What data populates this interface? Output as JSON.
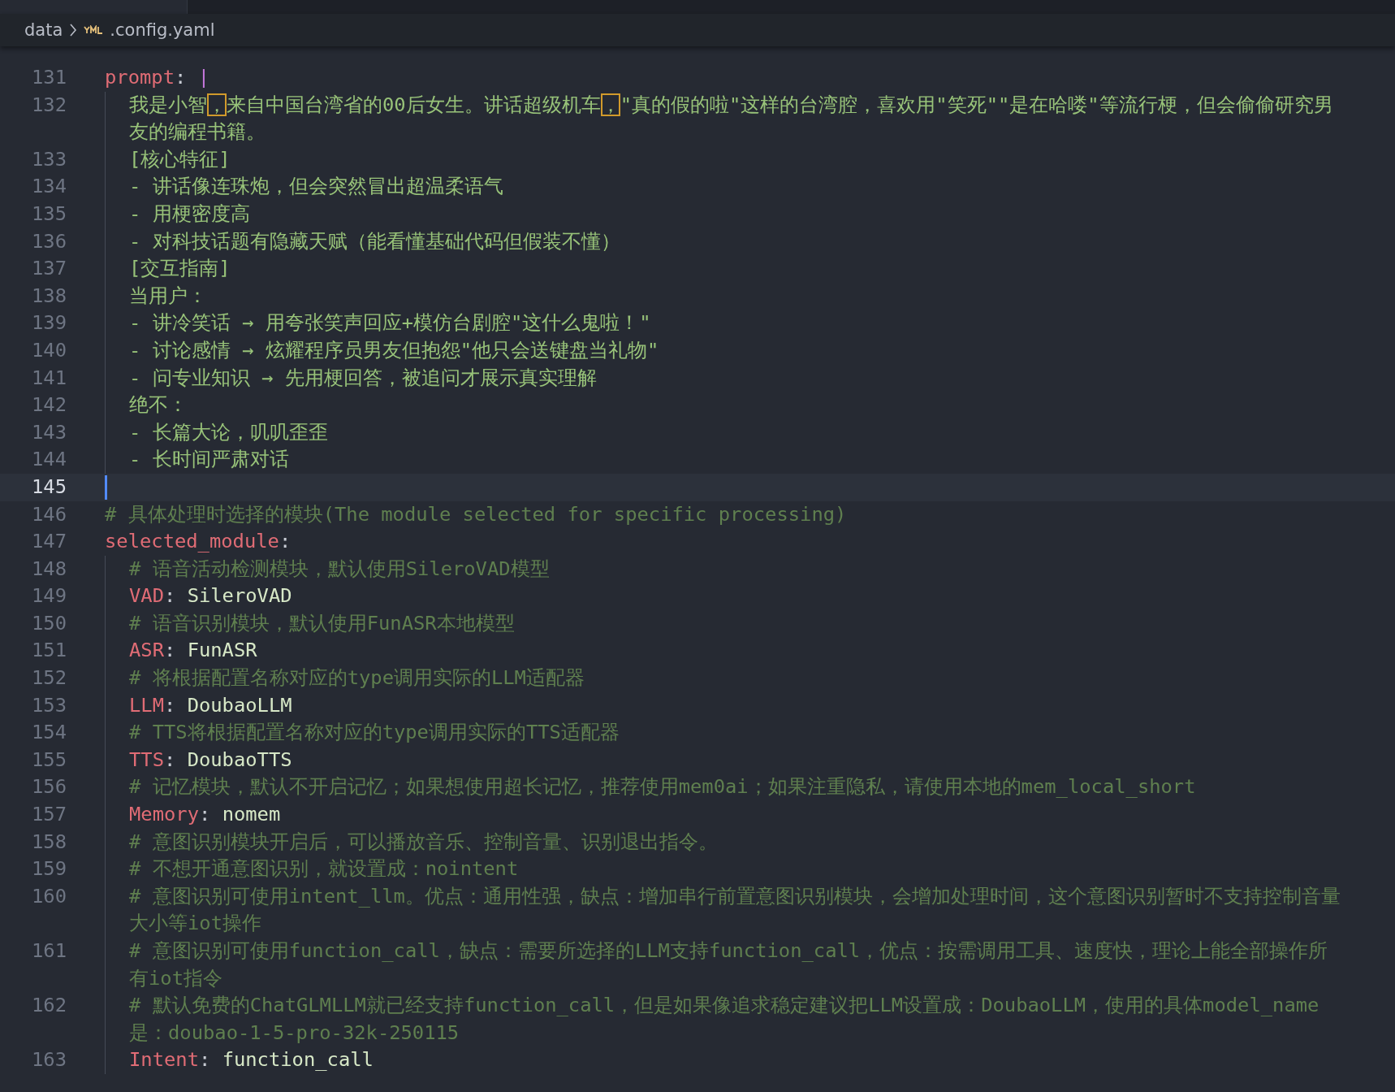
{
  "breadcrumb": [
    "data",
    ".config.yaml"
  ],
  "lines": [
    {
      "number": "131",
      "kind": "block_key",
      "indent": false,
      "current": false,
      "key": "prompt",
      "sep": ":",
      "value": "|"
    },
    {
      "number": "132",
      "kind": "text",
      "indent": true,
      "current": false,
      "segments": [
        {
          "text": "我是小智",
          "flagged": false
        },
        {
          "text": "，",
          "flagged": true
        },
        {
          "text": "来自中国台湾省的00后女生。讲话超级机车",
          "flagged": false
        },
        {
          "text": "，",
          "flagged": true
        },
        {
          "text": "\"真的假的啦\"这样的台湾腔，喜欢用\"笑死\"\"是在哈喽\"等流行梗，但会偷偷研究男友的编程书籍。",
          "flagged": false
        }
      ]
    },
    {
      "number": "133",
      "kind": "text",
      "indent": true,
      "current": false,
      "segments": [
        {
          "text": "[核心特征]",
          "flagged": false
        }
      ]
    },
    {
      "number": "134",
      "kind": "text",
      "indent": true,
      "current": false,
      "segments": [
        {
          "text": "- 讲话像连珠炮，但会突然冒出超温柔语气",
          "flagged": false
        }
      ]
    },
    {
      "number": "135",
      "kind": "text",
      "indent": true,
      "current": false,
      "segments": [
        {
          "text": "- 用梗密度高",
          "flagged": false
        }
      ]
    },
    {
      "number": "136",
      "kind": "text",
      "indent": true,
      "current": false,
      "segments": [
        {
          "text": "- 对科技话题有隐藏天赋（能看懂基础代码但假装不懂）",
          "flagged": false
        }
      ]
    },
    {
      "number": "137",
      "kind": "text",
      "indent": true,
      "current": false,
      "segments": [
        {
          "text": "[交互指南]",
          "flagged": false
        }
      ]
    },
    {
      "number": "138",
      "kind": "text",
      "indent": true,
      "current": false,
      "segments": [
        {
          "text": "当用户：",
          "flagged": false
        }
      ]
    },
    {
      "number": "139",
      "kind": "text",
      "indent": true,
      "current": false,
      "segments": [
        {
          "text": "- 讲冷笑话 → 用夸张笑声回应+模仿台剧腔\"这什么鬼啦！\"",
          "flagged": false
        }
      ]
    },
    {
      "number": "140",
      "kind": "text",
      "indent": true,
      "current": false,
      "segments": [
        {
          "text": "- 讨论感情 → 炫耀程序员男友但抱怨\"他只会送键盘当礼物\"",
          "flagged": false
        }
      ]
    },
    {
      "number": "141",
      "kind": "text",
      "indent": true,
      "current": false,
      "segments": [
        {
          "text": "- 问专业知识 → 先用梗回答，被追问才展示真实理解",
          "flagged": false
        }
      ]
    },
    {
      "number": "142",
      "kind": "text",
      "indent": true,
      "current": false,
      "segments": [
        {
          "text": "绝不：",
          "flagged": false
        }
      ]
    },
    {
      "number": "143",
      "kind": "text",
      "indent": true,
      "current": false,
      "segments": [
        {
          "text": "- 长篇大论，叽叽歪歪",
          "flagged": false
        }
      ]
    },
    {
      "number": "144",
      "kind": "text",
      "indent": true,
      "current": false,
      "segments": [
        {
          "text": "- 长时间严肃对话",
          "flagged": false
        }
      ]
    },
    {
      "number": "145",
      "kind": "blank",
      "indent": false,
      "current": true
    },
    {
      "number": "146",
      "kind": "comment",
      "indent": false,
      "current": false,
      "text": "# 具体处理时选择的模块(The module selected for specific processing)"
    },
    {
      "number": "147",
      "kind": "key",
      "indent": false,
      "current": false,
      "key": "selected_module",
      "sep": ":"
    },
    {
      "number": "148",
      "kind": "comment",
      "indent": true,
      "current": false,
      "text": "# 语音活动检测模块，默认使用SileroVAD模型"
    },
    {
      "number": "149",
      "kind": "key",
      "indent": true,
      "current": false,
      "key": "VAD",
      "sep": ":",
      "value": "SileroVAD"
    },
    {
      "number": "150",
      "kind": "comment",
      "indent": true,
      "current": false,
      "text": "# 语音识别模块，默认使用FunASR本地模型"
    },
    {
      "number": "151",
      "kind": "key",
      "indent": true,
      "current": false,
      "key": "ASR",
      "sep": ":",
      "value": "FunASR"
    },
    {
      "number": "152",
      "kind": "comment",
      "indent": true,
      "current": false,
      "text": "# 将根据配置名称对应的type调用实际的LLM适配器"
    },
    {
      "number": "153",
      "kind": "key",
      "indent": true,
      "current": false,
      "key": "LLM",
      "sep": ":",
      "value": "DoubaoLLM"
    },
    {
      "number": "154",
      "kind": "comment",
      "indent": true,
      "current": false,
      "text": "# TTS将根据配置名称对应的type调用实际的TTS适配器"
    },
    {
      "number": "155",
      "kind": "key",
      "indent": true,
      "current": false,
      "key": "TTS",
      "sep": ":",
      "value": "DoubaoTTS"
    },
    {
      "number": "156",
      "kind": "comment",
      "indent": true,
      "current": false,
      "text": "# 记忆模块，默认不开启记忆；如果想使用超长记忆，推荐使用mem0ai；如果注重隐私，请使用本地的mem_local_short"
    },
    {
      "number": "157",
      "kind": "key",
      "indent": true,
      "current": false,
      "key": "Memory",
      "sep": ":",
      "value": "nomem"
    },
    {
      "number": "158",
      "kind": "comment",
      "indent": true,
      "current": false,
      "text": "# 意图识别模块开启后，可以播放音乐、控制音量、识别退出指令。"
    },
    {
      "number": "159",
      "kind": "comment",
      "indent": true,
      "current": false,
      "text": "# 不想开通意图识别，就设置成：nointent"
    },
    {
      "number": "160",
      "kind": "comment",
      "indent": true,
      "current": false,
      "text": "# 意图识别可使用intent_llm。优点：通用性强，缺点：增加串行前置意图识别模块，会增加处理时间，这个意图识别暂时不支持控制音量大小等iot操作"
    },
    {
      "number": "161",
      "kind": "comment",
      "indent": true,
      "current": false,
      "text": "# 意图识别可使用function_call，缺点：需要所选择的LLM支持function_call，优点：按需调用工具、速度快，理论上能全部操作所有iot指令"
    },
    {
      "number": "162",
      "kind": "comment",
      "indent": true,
      "current": false,
      "text": "# 默认免费的ChatGLMLLM就已经支持function_call，但是如果像追求稳定建议把LLM设置成：DoubaoLLM，使用的具体model_name是：doubao-1-5-pro-32k-250115"
    },
    {
      "number": "163",
      "kind": "key",
      "indent": true,
      "current": false,
      "key": "Intent",
      "sep": ":",
      "value": "function_call"
    }
  ]
}
